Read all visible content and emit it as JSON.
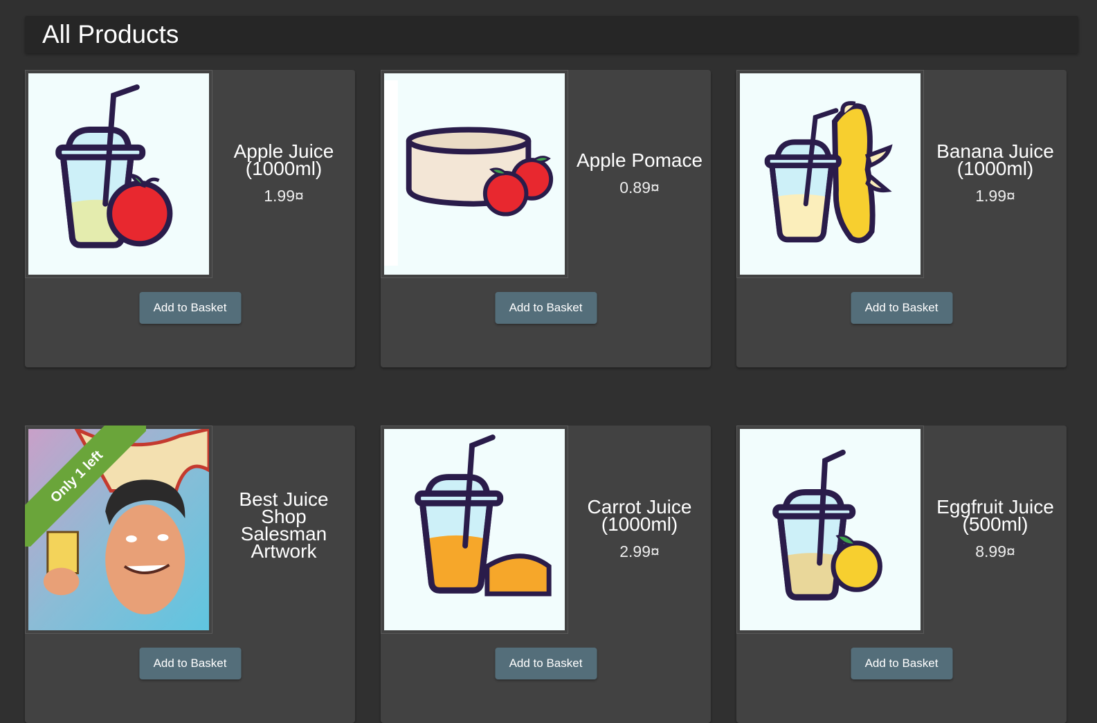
{
  "page": {
    "title": "All Products"
  },
  "products": [
    {
      "name": "Apple Juice (1000ml)",
      "price": "1.99¤",
      "button": "Add to Basket",
      "image": "apple-juice-cup-icon"
    },
    {
      "name": "Apple Pomace",
      "price": "0.89¤",
      "button": "Add to Basket",
      "image": "apple-pomace-icon"
    },
    {
      "name": "Banana Juice (1000ml)",
      "price": "1.99¤",
      "button": "Add to Basket",
      "image": "banana-juice-cup-icon"
    },
    {
      "name": "Best Juice Shop Salesman Artwork",
      "price": "",
      "button": "Add to Basket",
      "image": "salesman-artwork-image",
      "ribbon": "Only 1 left"
    },
    {
      "name": "Carrot Juice (1000ml)",
      "price": "2.99¤",
      "button": "Add to Basket",
      "image": "carrot-juice-cup-icon"
    },
    {
      "name": "Eggfruit Juice (500ml)",
      "price": "8.99¤",
      "button": "Add to Basket",
      "image": "eggfruit-juice-cup-icon"
    }
  ],
  "colors": {
    "background": "#303030",
    "card": "#424242",
    "button": "#546e7a",
    "ribbon": "#6aa53a",
    "outline": "#2a1c4a"
  }
}
